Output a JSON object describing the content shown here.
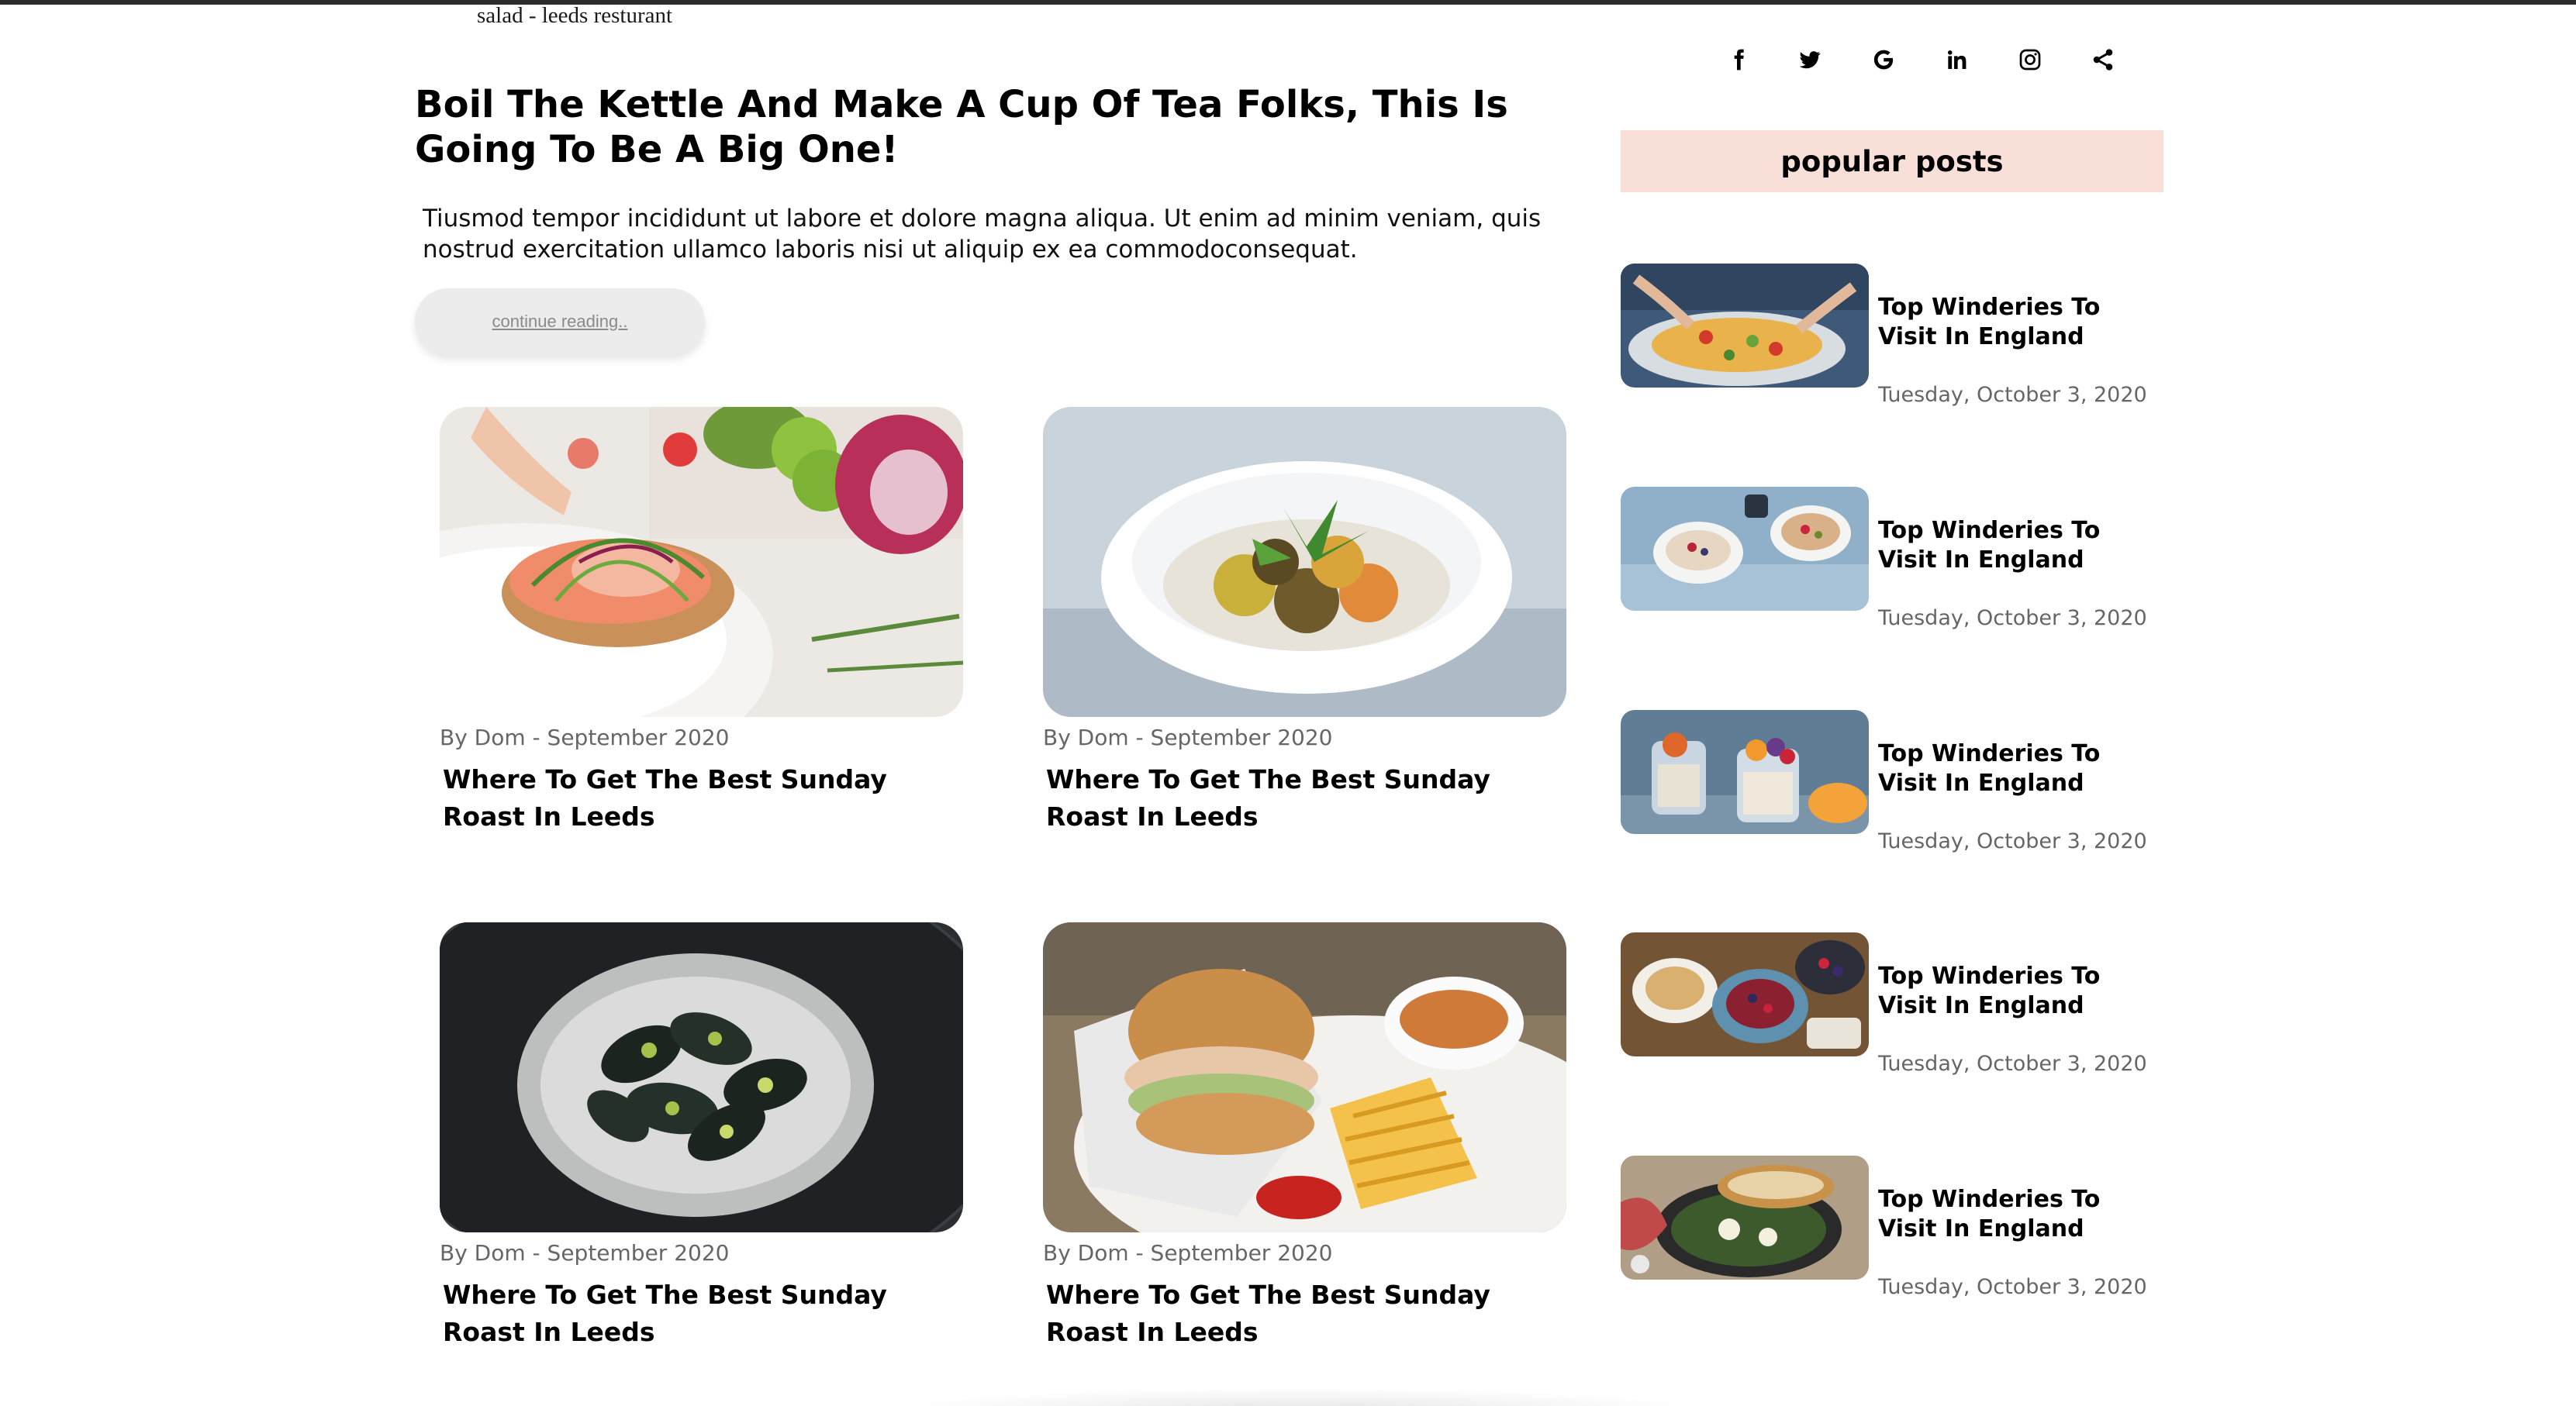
{
  "caption": "salad - leeds resturant",
  "hero": {
    "title": "Boil The Kettle And Make A Cup Of Tea Folks, This Is Going To Be A Big One!",
    "excerpt": "Tiusmod tempor incididunt ut labore et dolore magna aliqua. Ut enim ad minim veniam, quis nostrud exercitation ullamco laboris nisi ut aliquip ex ea commodoconsequat.",
    "continue_label": "continue reading.."
  },
  "posts": [
    {
      "meta": "By Dom - September 2020",
      "title": "Where To Get The Best Sunday Roast In Leeds",
      "image": "salmon-toast-photo"
    },
    {
      "meta": "By Dom - September 2020",
      "title": "Where To Get The Best Sunday Roast In Leeds",
      "image": "curry-bowl-photo"
    },
    {
      "meta": "By Dom - September 2020",
      "title": "Where To Get The Best Sunday Roast In Leeds",
      "image": "mussels-platter-photo"
    },
    {
      "meta": "By Dom - September 2020",
      "title": "Where To Get The Best Sunday Roast In Leeds",
      "image": "burger-fries-photo"
    }
  ],
  "social_icons": [
    "facebook-icon",
    "twitter-icon",
    "google-icon",
    "linkedin-icon",
    "instagram-icon",
    "share-icon"
  ],
  "popular": {
    "heading": "popular posts",
    "items": [
      {
        "title": "Top Winderies To Visit In England",
        "date": "Tuesday, October 3, 2020",
        "image": "nachos-photo"
      },
      {
        "title": "Top Winderies To Visit In England",
        "date": "Tuesday, October 3, 2020",
        "image": "breakfast-bowls-photo"
      },
      {
        "title": "Top Winderies To Visit In England",
        "date": "Tuesday, October 3, 2020",
        "image": "parfait-photo"
      },
      {
        "title": "Top Winderies To Visit In England",
        "date": "Tuesday, October 3, 2020",
        "image": "berries-table-photo"
      },
      {
        "title": "Top Winderies To Visit In England",
        "date": "Tuesday, October 3, 2020",
        "image": "skillet-toast-photo"
      }
    ]
  },
  "colors": {
    "popular_header_bg": "#f8e0d8",
    "button_bg": "#ececec",
    "meta_text": "#666666",
    "topbar": "#2c2c2c"
  }
}
